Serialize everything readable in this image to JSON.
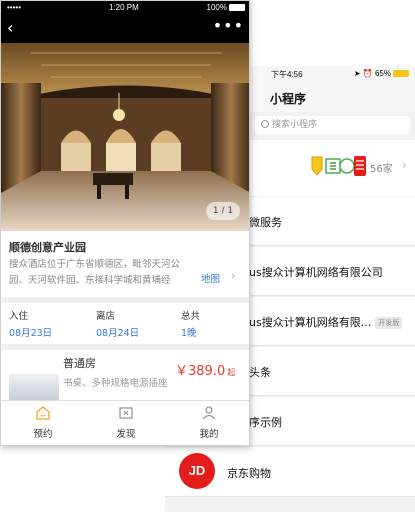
{
  "front": {
    "status": {
      "carrier": "•••••",
      "time": "1:20 PM",
      "battery": "100%"
    },
    "nav": {
      "back_icon": "‹",
      "more_icon": "•••"
    },
    "gallery": {
      "pager": "1 / 1"
    },
    "hotel": {
      "name": "顺德创意产业园",
      "description": "搜众酒店位于广东省顺德区，毗邻天河公园、天河软件园、东接科学城和黄埔经",
      "map_link": "地图"
    },
    "dates": {
      "checkin_label": "入住",
      "checkin_value": "08月23日",
      "checkout_label": "离店",
      "checkout_value": "08月24日",
      "total_label": "总共",
      "total_value": "1晚"
    },
    "room": {
      "name": "普通房",
      "description": "书桌、多种规格电源插座",
      "price": "￥389.0",
      "price_suffix": "起"
    },
    "tabs": [
      {
        "label": "预约",
        "icon": "home-icon",
        "color": "#f5a623"
      },
      {
        "label": "发现",
        "icon": "discover-icon",
        "color": "#999999"
      },
      {
        "label": "我的",
        "icon": "profile-icon",
        "color": "#999999"
      }
    ]
  },
  "back": {
    "status": {
      "time": "下午4:56",
      "battery": "65%"
    },
    "title": "小程序",
    "search_placeholder": "搜索小程序",
    "promo_count": "56家",
    "items": [
      {
        "label": "微服务"
      },
      {
        "label": "us搜众计算机网络有限公司"
      },
      {
        "label": "us搜众计算机网络有限...",
        "badge": "开发版"
      },
      {
        "label": "头条"
      },
      {
        "label": "序示例"
      },
      {
        "label": "京东购物",
        "logo": "JD"
      }
    ]
  },
  "colors": {
    "accent_blue": "#2f7bd8",
    "price_red": "#e8372c",
    "tab_active": "#f5a623",
    "jd_red": "#e31d1a"
  }
}
